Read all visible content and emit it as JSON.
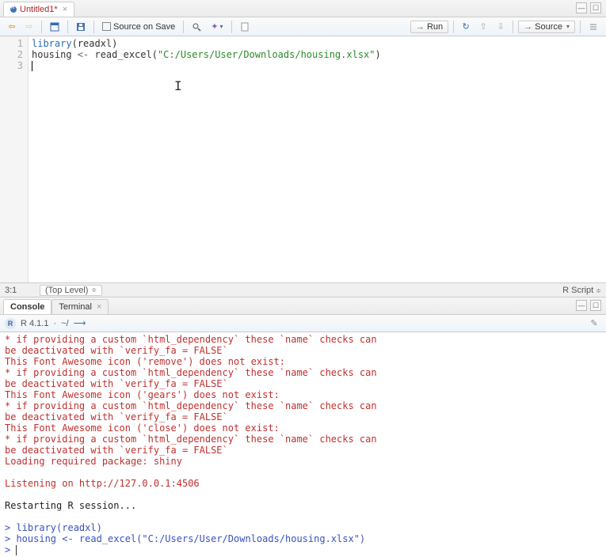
{
  "tabs": {
    "source": "Untitled1*"
  },
  "toolbar": {
    "sourceOnSave": "Source on Save",
    "run": "Run",
    "source": "Source"
  },
  "editor": {
    "lineNos": [
      "1",
      "2",
      "3"
    ],
    "l1_kw": "library",
    "l1_p1": "(",
    "l1_arg": "readxl",
    "l1_p2": ")",
    "l2_a": "housing ",
    "l2_op": "<-",
    "l2_b": " read_excel(",
    "l2_str": "\"C:/Users/User/Downloads/housing.xlsx\"",
    "l2_c": ")"
  },
  "status": {
    "pos": "3:1",
    "scope": "(Top Level)",
    "lang": "R Script"
  },
  "console": {
    "tab1": "Console",
    "tab2": "Terminal",
    "version": "R 4.1.1",
    "path": "~/",
    "lines": [
      {
        "cls": "red",
        "t": "* if providing a custom `html_dependency` these `name` checks can"
      },
      {
        "cls": "red",
        "t": "  be deactivated with `verify_fa = FALSE`"
      },
      {
        "cls": "red",
        "t": "This Font Awesome icon ('remove') does not exist:"
      },
      {
        "cls": "red",
        "t": "* if providing a custom `html_dependency` these `name` checks can"
      },
      {
        "cls": "red",
        "t": "  be deactivated with `verify_fa = FALSE`"
      },
      {
        "cls": "red",
        "t": "This Font Awesome icon ('gears') does not exist:"
      },
      {
        "cls": "red",
        "t": "* if providing a custom `html_dependency` these `name` checks can"
      },
      {
        "cls": "red",
        "t": "  be deactivated with `verify_fa = FALSE`"
      },
      {
        "cls": "red",
        "t": "This Font Awesome icon ('close') does not exist:"
      },
      {
        "cls": "red",
        "t": "* if providing a custom `html_dependency` these `name` checks can"
      },
      {
        "cls": "red",
        "t": "  be deactivated with `verify_fa = FALSE`"
      },
      {
        "cls": "red",
        "t": "Loading required package: shiny"
      },
      {
        "cls": "red",
        "t": ""
      },
      {
        "cls": "red",
        "t": "Listening on http://127.0.0.1:4506"
      },
      {
        "cls": "black",
        "t": ""
      },
      {
        "cls": "black",
        "t": "Restarting R session..."
      },
      {
        "cls": "black",
        "t": ""
      }
    ],
    "cmd1": "library(readxl)",
    "cmd2": "housing <- read_excel(\"C:/Users/User/Downloads/housing.xlsx\")"
  }
}
